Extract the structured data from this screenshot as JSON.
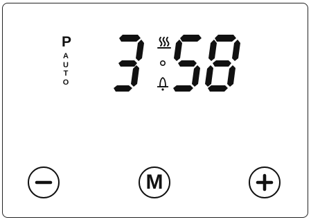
{
  "mode": {
    "program_letter": "P",
    "auto_letters": [
      "A",
      "U",
      "T",
      "O"
    ]
  },
  "display": {
    "time": "3:58",
    "hour_digit": "3",
    "minute_digits": [
      "5",
      "8"
    ],
    "indicators": [
      "heat-icon",
      "colon-dot",
      "alarm-bell-icon"
    ]
  },
  "buttons": {
    "minus": {
      "icon": "minus-icon"
    },
    "mode": {
      "label": "M"
    },
    "plus": {
      "icon": "plus-icon"
    }
  },
  "colors": {
    "ink": "#111111",
    "background": "#ffffff",
    "border": "#222222"
  }
}
